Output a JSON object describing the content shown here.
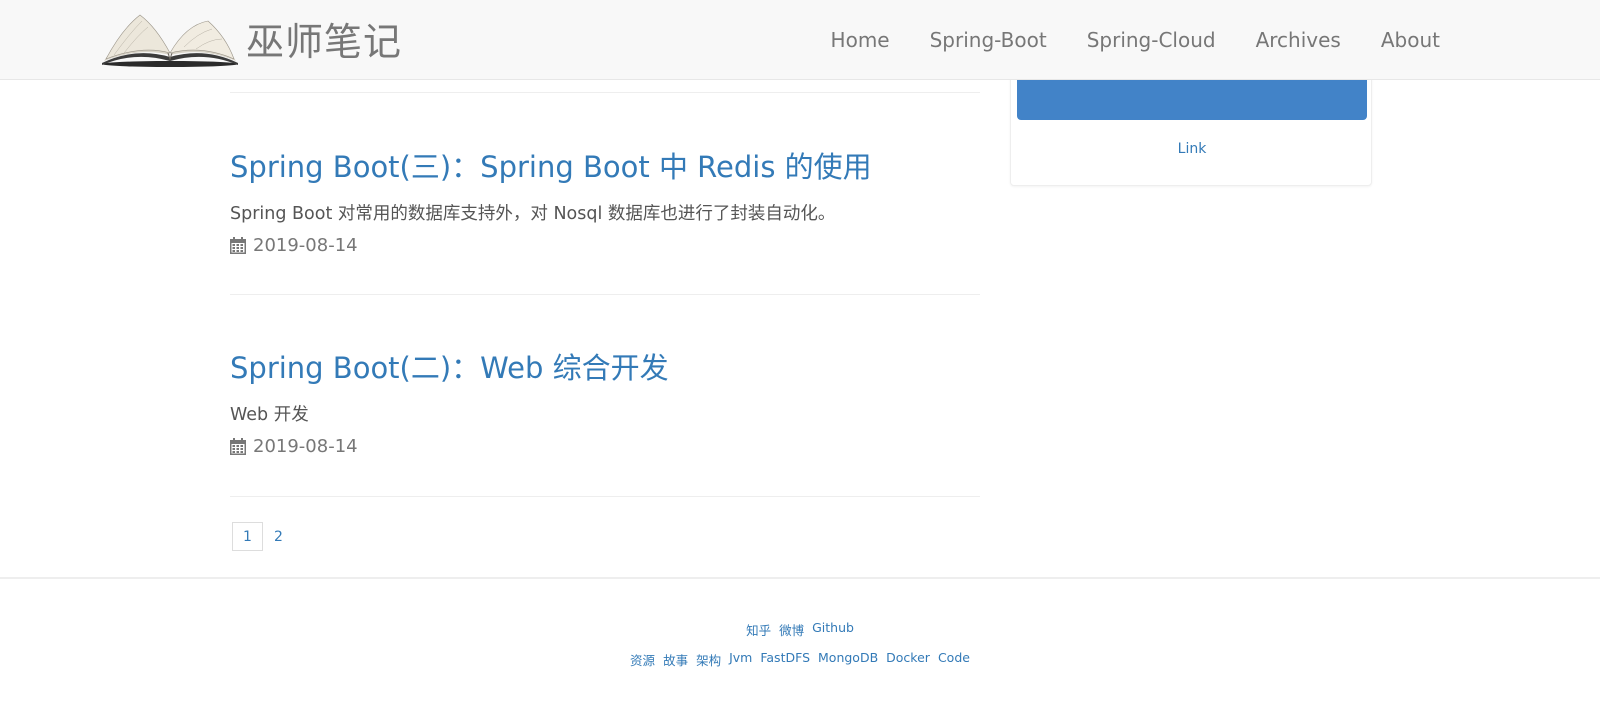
{
  "header": {
    "brand": "巫师笔记",
    "nav": [
      "Home",
      "Spring-Boot",
      "Spring-Cloud",
      "Archives",
      "About"
    ]
  },
  "posts": [
    {
      "title": "Spring Boot(三)：Spring Boot 中 Redis 的使用",
      "summary": "Spring Boot 对常用的数据库支持外，对 Nosql 数据库也进行了封装自动化。",
      "date": "2019-08-14"
    },
    {
      "title": "Spring Boot(二)：Web 综合开发",
      "summary": "Web 开发",
      "date": "2019-08-14"
    }
  ],
  "pagination": {
    "current": "1",
    "next": "2"
  },
  "sidebar": {
    "link": "Link"
  },
  "footer": {
    "row1": [
      "知乎",
      "微博",
      "Github"
    ],
    "row2": [
      "资源",
      "故事",
      "架构",
      "Jvm",
      "FastDFS",
      "MongoDB",
      "Docker",
      "Code"
    ]
  },
  "colors": {
    "link": "#337ab7",
    "button": "#4283c8",
    "navbar_bg": "#f8f8f8",
    "text": "#555555"
  },
  "icons": {
    "post_date": "calendar-icon",
    "brand": "open-book-logo"
  }
}
